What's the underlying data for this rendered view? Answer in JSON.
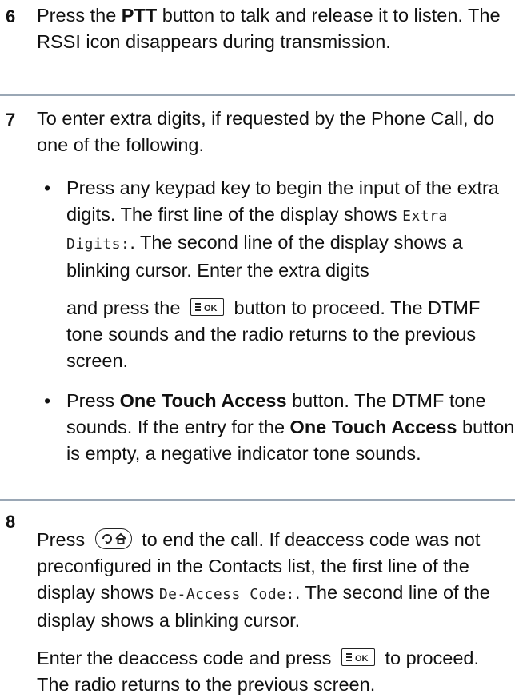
{
  "step6": {
    "number": "6",
    "t1": "Press the ",
    "b1": "PTT",
    "t2": " button to talk and release it to listen. The RSSI icon disappears during transmission."
  },
  "step7": {
    "number": "7",
    "intro": "To enter extra digits, if requested by the Phone Call, do one of the following.",
    "bullet1": {
      "marker": "•",
      "t1": "Press any keypad key to begin the input of the extra digits. The first line of the display shows ",
      "display1": "Extra Digits:",
      "t2": ". The second line of the display shows a blinking cursor. Enter the extra digits",
      "t3": "and press the ",
      "t4": " button to proceed. The DTMF tone sounds and the radio returns to the previous screen."
    },
    "bullet2": {
      "marker": "•",
      "t1": "Press ",
      "b1": "One Touch Access",
      "t2": " button. The DTMF tone sounds. If the entry for the ",
      "b2": "One Touch Access",
      "t3": " button is empty, a negative indicator tone sounds."
    }
  },
  "step8": {
    "number": "8",
    "t1": "Press ",
    "t2": " to end the call. If deaccess code was not preconfigured in the Contacts list, the first line of the display shows ",
    "display1": "De-Access Code:",
    "t3": ". The second line of the display shows a blinking cursor.",
    "t4": "Enter the deaccess code and press ",
    "t5": " to proceed. The radio returns to the previous screen."
  },
  "icons": {
    "ok_key": "menu-ok-key-icon",
    "end_key": "back-home-key-icon"
  },
  "colors": {
    "divider": "#9aa7b5",
    "text": "#111111"
  }
}
